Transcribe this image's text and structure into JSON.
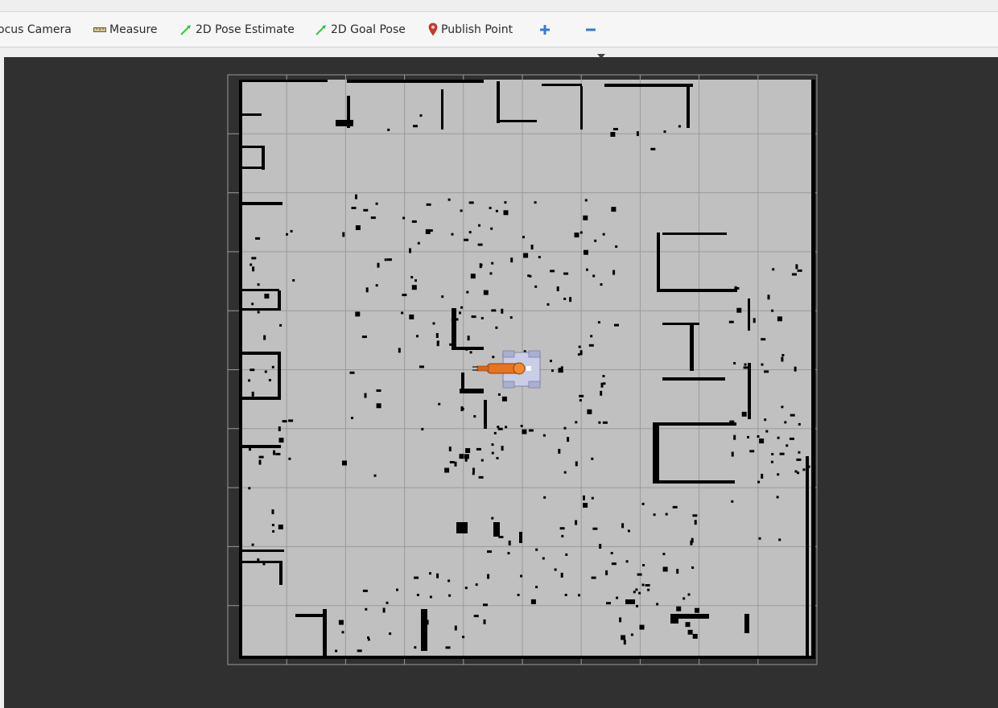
{
  "toolbar": {
    "focus_camera": {
      "label": "ocus Camera"
    },
    "measure": {
      "label": "Measure",
      "icon": "ruler-icon"
    },
    "pose_estimate": {
      "label": "2D Pose Estimate",
      "icon": "green-arrow-icon"
    },
    "goal_pose": {
      "label": "2D Goal Pose",
      "icon": "green-arrow-icon"
    },
    "publish_point": {
      "label": "Publish Point",
      "icon": "map-pin-icon"
    },
    "add_tool": {
      "icon": "plus-icon"
    },
    "remove_tool": {
      "icon": "minus-icon"
    },
    "more": {
      "icon": "chevron-down-icon"
    }
  },
  "colors": {
    "viewport_bg": "#303030",
    "map_free": "#c0c0c0",
    "obstacle": "#000000",
    "grid": "#9a9a9a",
    "tool_arrow": "#2ecc40",
    "tool_blue": "#3b78d8",
    "pin_red": "#c0392b",
    "robot_arm": "#e8741e",
    "robot_base": "#c9cde6"
  },
  "map": {
    "view": "2D occupancy grid (top-down)",
    "grid_cells": [
      10,
      10
    ],
    "robot_icon": "mobile-manipulator-icon"
  }
}
